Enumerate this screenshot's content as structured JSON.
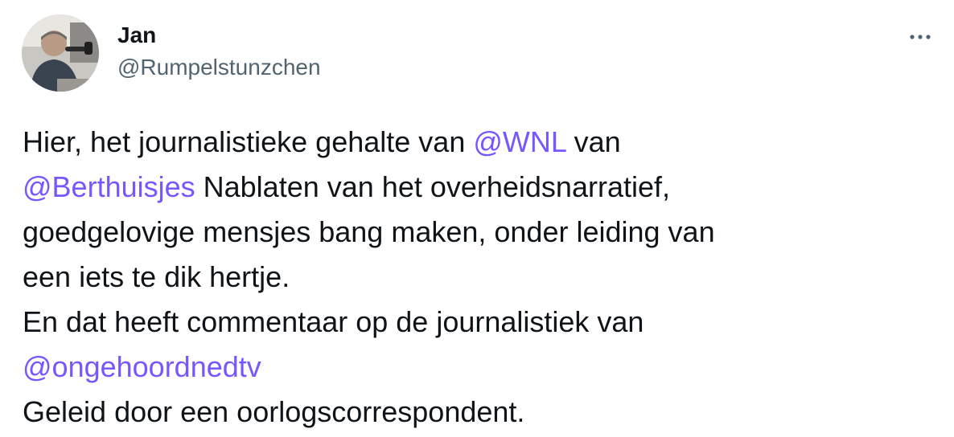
{
  "author": {
    "name": "Jan",
    "handle": "@Rumpelstunzchen",
    "avatar_icon": "profile-photo"
  },
  "menu_icon": "more-horizontal-icon",
  "tweet": {
    "line1": {
      "a": "Hier, het journalistieke gehalte van ",
      "mention": "@WNL",
      "b": " van"
    },
    "line2": {
      "mention": "@Berthuisjes",
      "b": " Nablaten van het overheidsnarratief,"
    },
    "line3": "goedgelovige mensjes bang maken, onder leiding van",
    "line4": "een iets te dik hertje.",
    "line5": "En dat heeft commentaar op de journalistiek van",
    "line6": {
      "mention": "@ongehoordnedtv"
    },
    "line7": "Geleid door een oorlogscorrespondent."
  },
  "colors": {
    "text": "#0f1419",
    "secondary": "#536471",
    "mention": "#7856ff"
  }
}
